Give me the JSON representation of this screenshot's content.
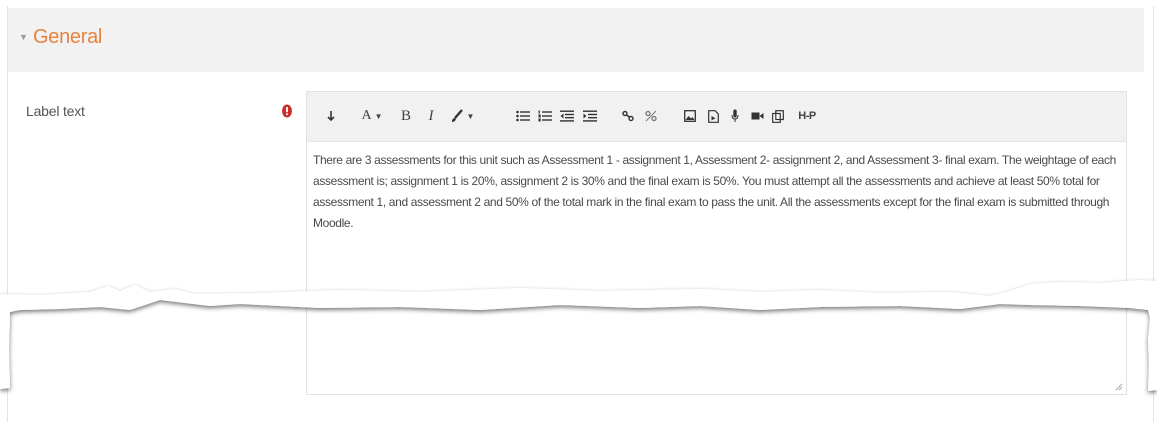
{
  "section": {
    "title": "General",
    "expanded": true,
    "accent_color": "#e8823f"
  },
  "field": {
    "label": "Label text",
    "required": true,
    "required_color": "#c9302c"
  },
  "toolbar": {
    "icons": [
      "show-more-icon",
      "font-size-icon",
      "bold-icon",
      "italic-icon",
      "text-color-icon",
      "unordered-list-icon",
      "ordered-list-icon",
      "outdent-icon",
      "indent-icon",
      "link-icon",
      "unlink-icon",
      "image-icon",
      "media-icon",
      "record-audio-icon",
      "record-video-icon",
      "manage-files-icon",
      "h5p-icon"
    ],
    "font_size_label": "A",
    "bold_label": "B",
    "italic_label": "I",
    "h5p_label": "H-P"
  },
  "editor": {
    "text": "There are 3 assessments for this unit such as Assessment 1 - assignment 1, Assessment 2- assignment 2, and Assessment 3- final exam.  The weightage of each assessment is; assignment 1 is 20%, assignment 2  is 30% and the final exam is 50%. You must attempt all the assessments and achieve at least 50% total for assessment 1, and assessment 2 and 50% of the total mark in the final exam to pass the unit.  All the assessments except for the final exam is submitted through Moodle."
  }
}
